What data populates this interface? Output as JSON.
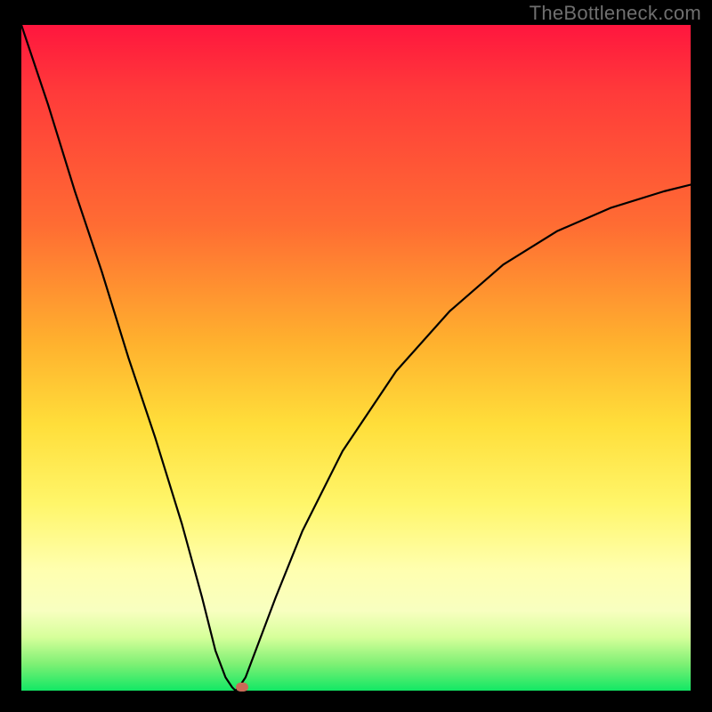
{
  "watermark": "TheBottleneck.com",
  "colors": {
    "frame_bg": "#000000",
    "curve_stroke": "#000000",
    "marker_fill": "#c96a57",
    "gradient_top": "#ff163e",
    "gradient_bottom": "#12e865"
  },
  "chart_data": {
    "type": "line",
    "title": "",
    "xlabel": "",
    "ylabel": "",
    "xlim": [
      0,
      100
    ],
    "ylim": [
      0,
      100
    ],
    "x": [
      0,
      4,
      8,
      12,
      16,
      20,
      24,
      27,
      29,
      30.5,
      31.5,
      32,
      32.5,
      33.5,
      35,
      38,
      42,
      48,
      56,
      64,
      72,
      80,
      88,
      96,
      100
    ],
    "values": [
      100,
      88,
      75,
      63,
      50,
      38,
      25,
      14,
      6,
      2,
      0.5,
      0,
      0.5,
      2,
      6,
      14,
      24,
      36,
      48,
      57,
      64,
      69,
      72.5,
      75,
      76
    ],
    "annotations": [
      {
        "type": "marker",
        "x": 33,
        "y": 0.5,
        "shape": "rounded-rect"
      }
    ]
  }
}
